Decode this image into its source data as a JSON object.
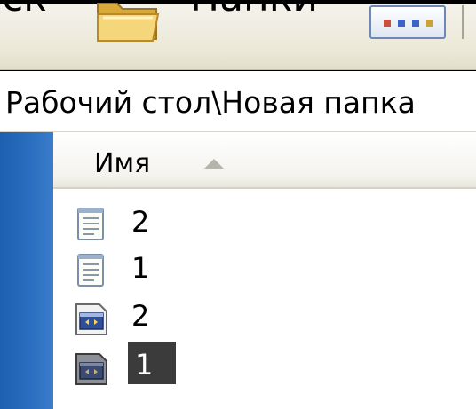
{
  "toolbar": {
    "left_text": "ск",
    "folders_label": "Папки",
    "folder_icon": "folder-icon",
    "views_icon": "views-icon"
  },
  "address": {
    "path": "Рабочий стол\\Новая папка"
  },
  "filelist": {
    "column_name": "Имя",
    "sort": "ascending",
    "items": [
      {
        "name": "2",
        "icon": "text-document-icon",
        "selected": false
      },
      {
        "name": "1",
        "icon": "text-document-icon",
        "selected": false
      },
      {
        "name": "2",
        "icon": "batch-file-icon",
        "selected": false
      },
      {
        "name": "1",
        "icon": "batch-file-icon",
        "selected": true
      }
    ]
  },
  "colors": {
    "toolbar_bg": "#ece9d8",
    "left_pane": "#2b6fc0",
    "selection": "#3b3b3b"
  }
}
